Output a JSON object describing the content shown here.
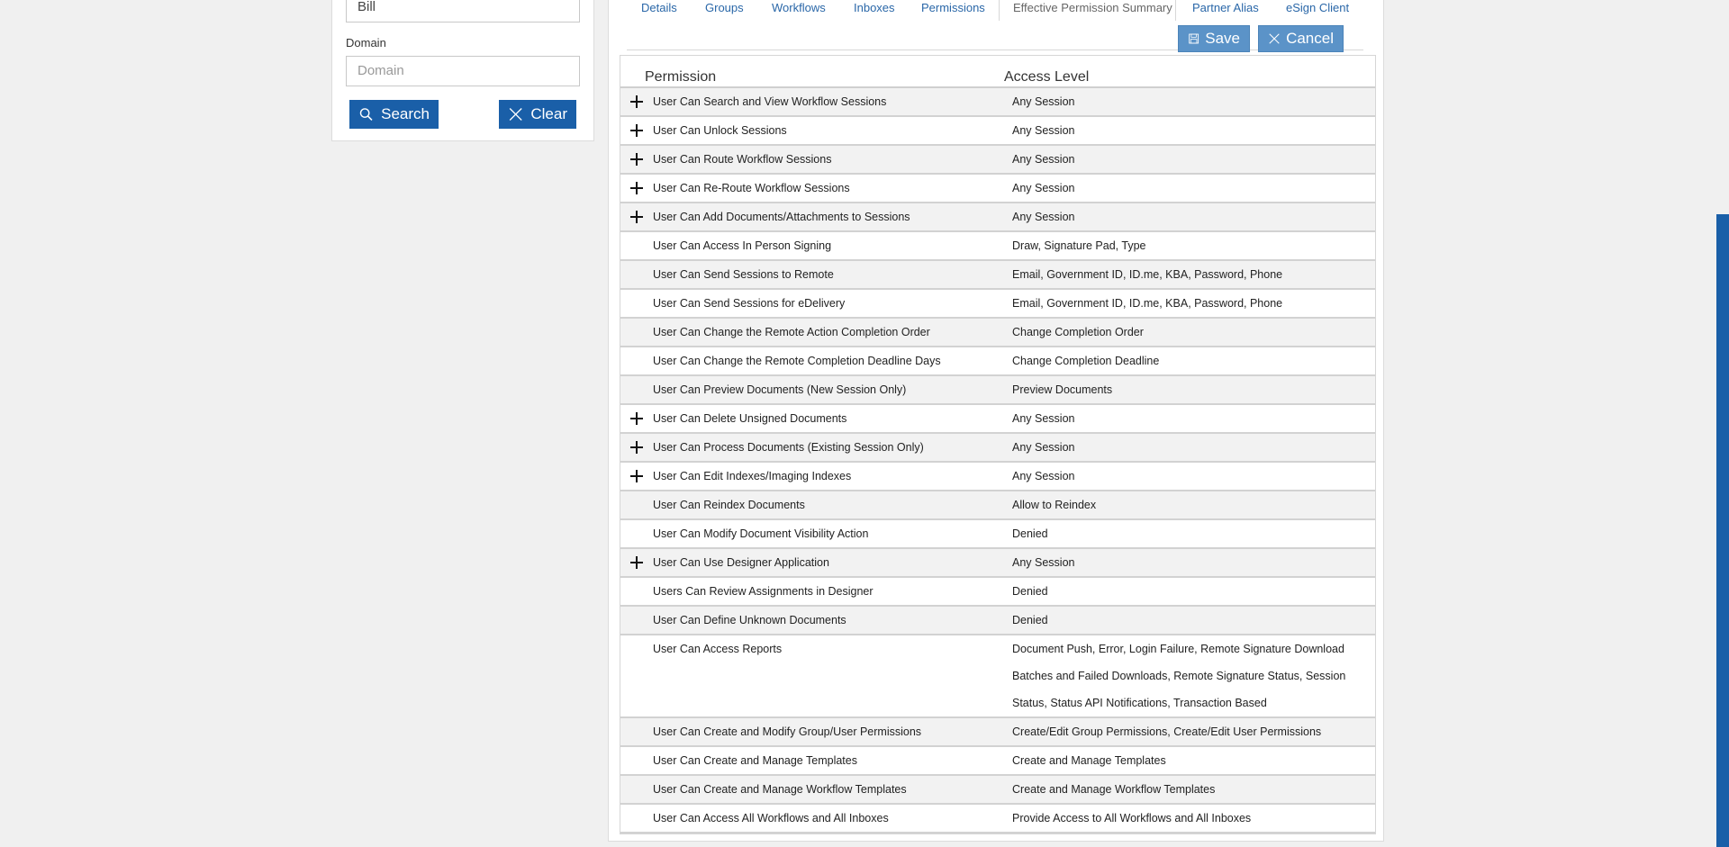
{
  "search": {
    "name_value": "Bill",
    "domain_label": "Domain",
    "domain_placeholder": "Domain",
    "search_label": "Search",
    "clear_label": "Clear"
  },
  "tabs": [
    {
      "label": "Details"
    },
    {
      "label": "Groups"
    },
    {
      "label": "Workflows"
    },
    {
      "label": "Inboxes"
    },
    {
      "label": "Permissions"
    },
    {
      "label": "Effective Permission Summary",
      "active": true
    },
    {
      "label": "Partner Alias"
    },
    {
      "label": "eSign Client"
    }
  ],
  "actions": {
    "save_label": "Save",
    "cancel_label": "Cancel"
  },
  "table": {
    "header_permission": "Permission",
    "header_access": "Access Level",
    "rows": [
      {
        "permission": "User Can Search and View Workflow Sessions",
        "access": "Any Session",
        "expandable": true
      },
      {
        "permission": "User Can Unlock Sessions",
        "access": "Any Session",
        "expandable": true
      },
      {
        "permission": "User Can Route Workflow Sessions",
        "access": "Any Session",
        "expandable": true
      },
      {
        "permission": "User Can Re-Route Workflow Sessions",
        "access": "Any Session",
        "expandable": true
      },
      {
        "permission": "User Can Add Documents/Attachments to Sessions",
        "access": "Any Session",
        "expandable": true
      },
      {
        "permission": "User Can Access In Person Signing",
        "access": "Draw, Signature Pad, Type",
        "expandable": false
      },
      {
        "permission": "User Can Send Sessions to Remote",
        "access": "Email, Government ID, ID.me, KBA, Password, Phone",
        "expandable": false
      },
      {
        "permission": "User Can Send Sessions for eDelivery",
        "access": "Email, Government ID, ID.me, KBA, Password, Phone",
        "expandable": false
      },
      {
        "permission": "User Can Change the Remote Action Completion Order",
        "access": "Change Completion Order",
        "expandable": false
      },
      {
        "permission": "User Can Change the Remote Completion Deadline Days",
        "access": "Change Completion Deadline",
        "expandable": false
      },
      {
        "permission": "User Can Preview Documents (New Session Only)",
        "access": "Preview Documents",
        "expandable": false
      },
      {
        "permission": "User Can Delete Unsigned Documents",
        "access": "Any Session",
        "expandable": true
      },
      {
        "permission": "User Can Process Documents (Existing Session Only)",
        "access": "Any Session",
        "expandable": true
      },
      {
        "permission": "User Can Edit Indexes/Imaging Indexes",
        "access": "Any Session",
        "expandable": true
      },
      {
        "permission": "User Can Reindex Documents",
        "access": "Allow to Reindex",
        "expandable": false
      },
      {
        "permission": "User Can Modify Document Visibility Action",
        "access": "Denied",
        "expandable": false
      },
      {
        "permission": "User Can Use Designer Application",
        "access": "Any Session",
        "expandable": true
      },
      {
        "permission": "Users Can Review Assignments in Designer",
        "access": "Denied",
        "expandable": false
      },
      {
        "permission": "User Can Define Unknown Documents",
        "access": "Denied",
        "expandable": false
      },
      {
        "permission": "User Can Access Reports",
        "access": "Document Push, Error, Login Failure, Remote Signature Download Batches and Failed Downloads, Remote Signature Status, Session Status, Status API Notifications, Transaction Based",
        "expandable": false
      },
      {
        "permission": "User Can Create and Modify Group/User Permissions",
        "access": "Create/Edit Group Permissions, Create/Edit User Permissions",
        "expandable": false
      },
      {
        "permission": "User Can Create and Manage Templates",
        "access": "Create and Manage Templates",
        "expandable": false
      },
      {
        "permission": "User Can Create and Manage Workflow Templates",
        "access": "Create and Manage Workflow Templates",
        "expandable": false
      },
      {
        "permission": "User Can Access All Workflows and All Inboxes",
        "access": "Provide Access to All Workflows and All Inboxes",
        "expandable": false
      }
    ]
  }
}
